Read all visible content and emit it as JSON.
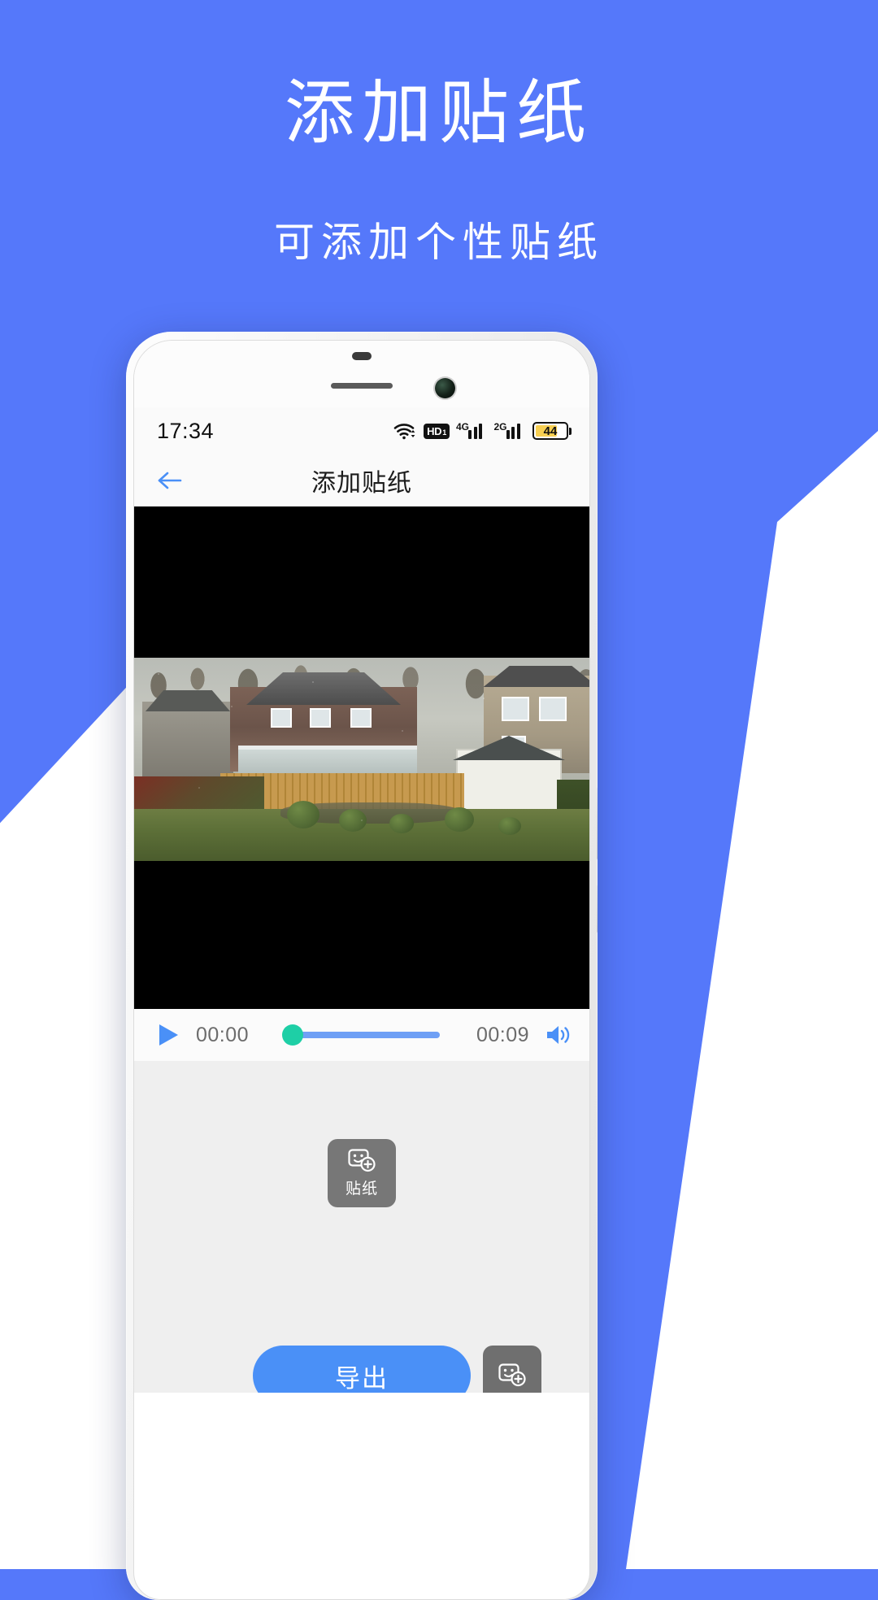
{
  "promo": {
    "title": "添加贴纸",
    "subtitle": "可添加个性贴纸",
    "background_color": "#5578fa",
    "text_color": "#ffffff"
  },
  "phone": {
    "status_bar": {
      "time": "17:34",
      "icons": [
        "wifi-icon",
        "hd-voice-icon",
        "signal-4g-icon",
        "signal-2g-icon",
        "battery-icon"
      ],
      "hd_label": "HD",
      "hd_sub": "1",
      "network_1": "4G",
      "network_2": "2G",
      "battery_percent": "44"
    },
    "app_bar": {
      "back_icon": "arrow-left-icon",
      "title": "添加贴纸",
      "accent_color": "#4a90f7"
    },
    "player": {
      "play_icon": "play-icon",
      "current_time": "00:00",
      "duration": "00:09",
      "volume_icon": "volume-on-icon",
      "progress_percent": 0,
      "track_color": "#6fa0f5",
      "thumb_color": "#1ecfa6"
    },
    "tool_panel": {
      "sticker_button_label": "贴纸",
      "sticker_button_icon": "sticker-add-icon",
      "button_color": "#777777"
    },
    "bottom_bar": {
      "export_label": "导出",
      "export_color": "#4a90f7",
      "shortcut_icon": "sticker-add-icon",
      "shortcut_color": "#6f6f6f"
    }
  }
}
